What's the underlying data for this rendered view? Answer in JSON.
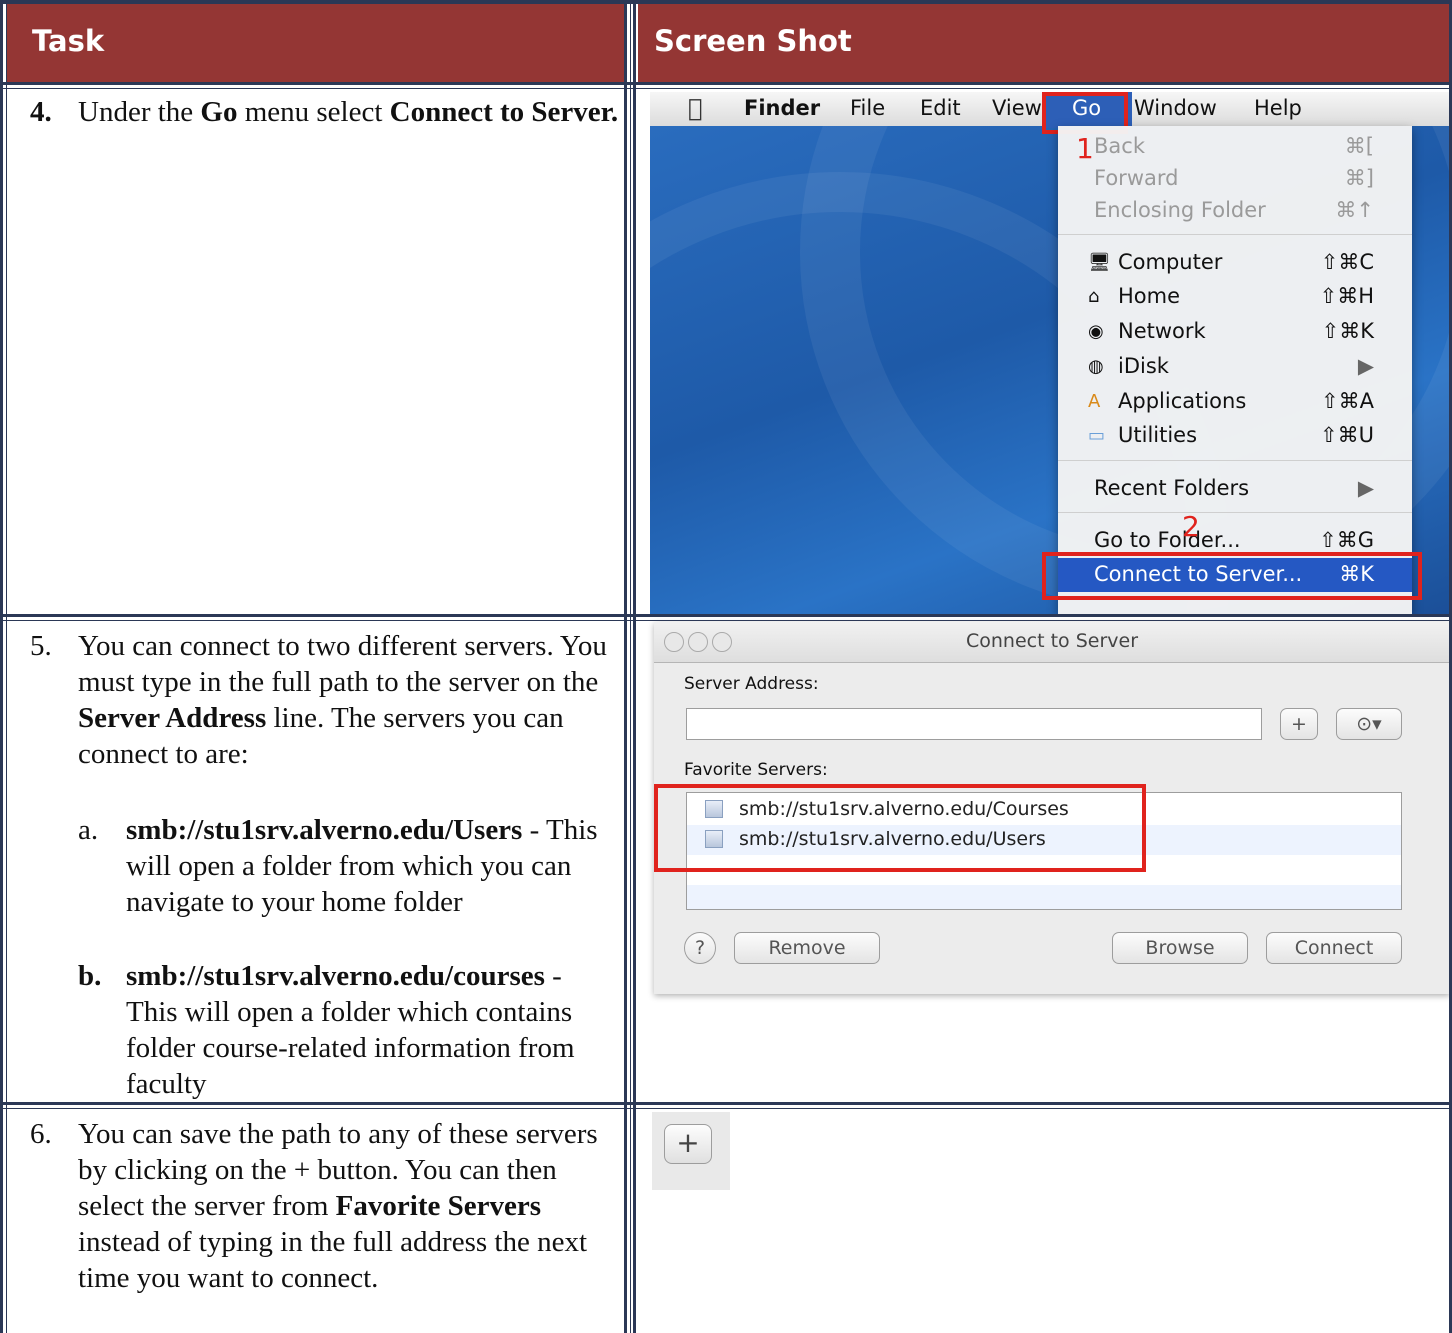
{
  "headers": {
    "task": "Task",
    "screenshot": "Screen Shot"
  },
  "steps": {
    "s4": {
      "num": "4.",
      "t1": "Under the ",
      "b1": "Go",
      "t2": " menu select ",
      "b2": "Connect to Server."
    },
    "s5": {
      "num": "5.",
      "t1": "You can connect to two different servers. You must type in the full path to the server on the ",
      "b1": "Server Address",
      "t2": " line. The servers you can connect to are:",
      "a": {
        "num": "a.",
        "b": "smb://stu1srv.alverno.edu/Users",
        "t": " - This will open a folder from which you can navigate to your home folder"
      },
      "b": {
        "num": "b.",
        "b": "smb://stu1srv.alverno.edu/courses",
        "t": " - This will open a folder which contains folder course-related information from faculty"
      }
    },
    "s6": {
      "num": "6.",
      "t1": "You can save the path to any of these servers by clicking on the + button.  You can then select the server from ",
      "b1": "Favorite Servers",
      "t2": " instead of typing in the full address the next time you want to connect."
    }
  },
  "shot1": {
    "menubar": {
      "finder": "Finder",
      "file": "File",
      "edit": "Edit",
      "view": "View",
      "go": "Go",
      "window": "Window",
      "help": "Help"
    },
    "menu": {
      "back": "Back",
      "back_sc": "⌘[",
      "forward": "Forward",
      "forward_sc": "⌘]",
      "enclosing": "Enclosing Folder",
      "enclosing_sc": "⌘↑",
      "computer": "Computer",
      "computer_sc": "⇧⌘C",
      "home": "Home",
      "home_sc": "⇧⌘H",
      "network": "Network",
      "network_sc": "⇧⌘K",
      "idisk": "iDisk",
      "idisk_sc": "▶",
      "applications": "Applications",
      "applications_sc": "⇧⌘A",
      "utilities": "Utilities",
      "utilities_sc": "⇧⌘U",
      "recent": "Recent Folders",
      "recent_sc": "▶",
      "goto": "Go to Folder...",
      "goto_sc": "⇧⌘G",
      "connect": "Connect to Server...",
      "connect_sc": "⌘K"
    },
    "marker1": "1",
    "marker2": "2",
    "colors": {
      "highlight": "#e0231d",
      "selection": "#2558c3"
    }
  },
  "shot2": {
    "title": "Connect to Server",
    "server_address_label": "Server Address:",
    "server_address_value": "",
    "plus": "+",
    "recent": "⊙▾",
    "favorites_label": "Favorite Servers:",
    "favorites": [
      "smb://stu1srv.alverno.edu/Courses",
      "smb://stu1srv.alverno.edu/Users"
    ],
    "help": "?",
    "remove": "Remove",
    "browse": "Browse",
    "connect": "Connect"
  },
  "shot3": {
    "plus": "+"
  },
  "colors": {
    "header_bg": "#943634",
    "border": "#2b3856"
  }
}
